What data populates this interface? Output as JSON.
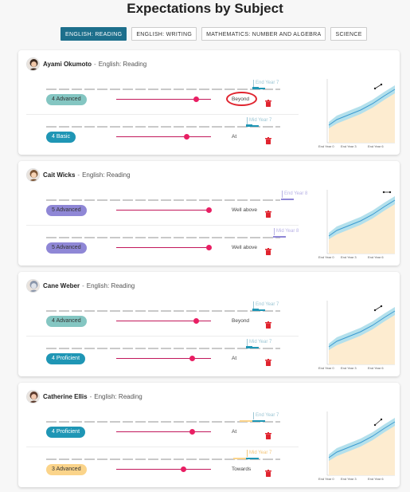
{
  "page": {
    "title": "Expectations by Subject"
  },
  "tabs": [
    {
      "label": "ENGLISH: READING",
      "active": true
    },
    {
      "label": "ENGLISH: WRITING",
      "active": false
    },
    {
      "label": "MATHEMATICS: NUMBER AND ALGEBRA",
      "active": false
    },
    {
      "label": "SCIENCE",
      "active": false
    }
  ],
  "colors": {
    "advanced_green": "#84c6c2",
    "advanced_purple": "#8f87d6",
    "basic_blue": "#1f96b5",
    "proficient_blue": "#1f96b5",
    "advanced_yellow": "#fbd48a",
    "slider": "#e91e63",
    "trash": "#e0242f"
  },
  "chart_ticks": [
    "End Year 0",
    "End Year 3",
    "End Year 6"
  ],
  "cards": [
    {
      "student": "Ayami Okumoto",
      "separator": "-",
      "subject": "English: Reading",
      "rows": [
        {
          "marker_label": "End Year 7",
          "badge": "4 Advanced",
          "level": "Beyond",
          "highlighted": true
        },
        {
          "marker_label": "Mid Year 7",
          "badge": "4 Basic",
          "level": "At",
          "highlighted": false
        }
      ]
    },
    {
      "student": "Cait Wicks",
      "separator": "-",
      "subject": "English: Reading",
      "rows": [
        {
          "marker_label": "End Year 8",
          "badge": "5 Advanced",
          "level": "Well above",
          "highlighted": false
        },
        {
          "marker_label": "Mid Year 8",
          "badge": "5 Advanced",
          "level": "Well above",
          "highlighted": false
        }
      ]
    },
    {
      "student": "Cane Weber",
      "separator": "-",
      "subject": "English: Reading",
      "rows": [
        {
          "marker_label": "End Year 7",
          "badge": "4 Advanced",
          "level": "Beyond",
          "highlighted": false
        },
        {
          "marker_label": "Mid Year 7",
          "badge": "4 Proficient",
          "level": "At",
          "highlighted": false
        }
      ]
    },
    {
      "student": "Catherine Ellis",
      "separator": "-",
      "subject": "English: Reading",
      "rows": [
        {
          "marker_label": "End Year 7",
          "badge": "4 Proficient",
          "level": "At",
          "highlighted": false
        },
        {
          "marker_label": "Mid Year 7",
          "badge": "3 Advanced",
          "level": "Towards",
          "highlighted": false
        }
      ]
    }
  ]
}
